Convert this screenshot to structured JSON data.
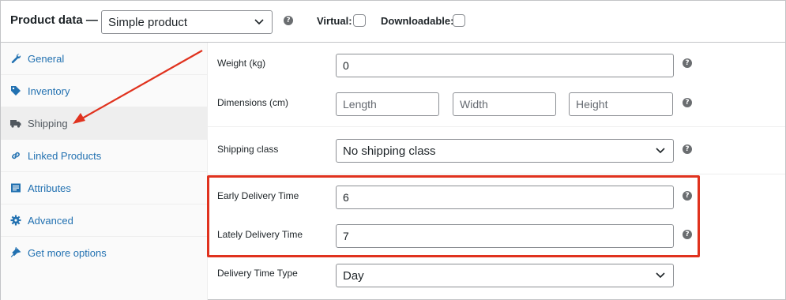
{
  "header": {
    "title": "Product data —",
    "product_type": "Simple product",
    "virtual_label": "Virtual:",
    "downloadable_label": "Downloadable:"
  },
  "sidebar": {
    "items": [
      {
        "label": "General",
        "icon": "wrench-icon"
      },
      {
        "label": "Inventory",
        "icon": "tag-icon"
      },
      {
        "label": "Shipping",
        "icon": "truck-icon",
        "active": true
      },
      {
        "label": "Linked Products",
        "icon": "link-icon"
      },
      {
        "label": "Attributes",
        "icon": "table-icon"
      },
      {
        "label": "Advanced",
        "icon": "gear-icon"
      },
      {
        "label": "Get more options",
        "icon": "plugin-icon"
      }
    ]
  },
  "shipping": {
    "weight_label": "Weight (kg)",
    "weight_value": "0",
    "dimensions_label": "Dimensions (cm)",
    "length_placeholder": "Length",
    "width_placeholder": "Width",
    "height_placeholder": "Height",
    "shipping_class_label": "Shipping class",
    "shipping_class_value": "No shipping class",
    "early_delivery_label": "Early Delivery Time",
    "early_delivery_value": "6",
    "lately_delivery_label": "Lately Delivery Time",
    "lately_delivery_value": "7",
    "delivery_type_label": "Delivery Time Type",
    "delivery_type_value": "Day"
  },
  "colors": {
    "link": "#2271b1",
    "annotation": "#e0321e",
    "help_icon": "#6a6d70"
  }
}
